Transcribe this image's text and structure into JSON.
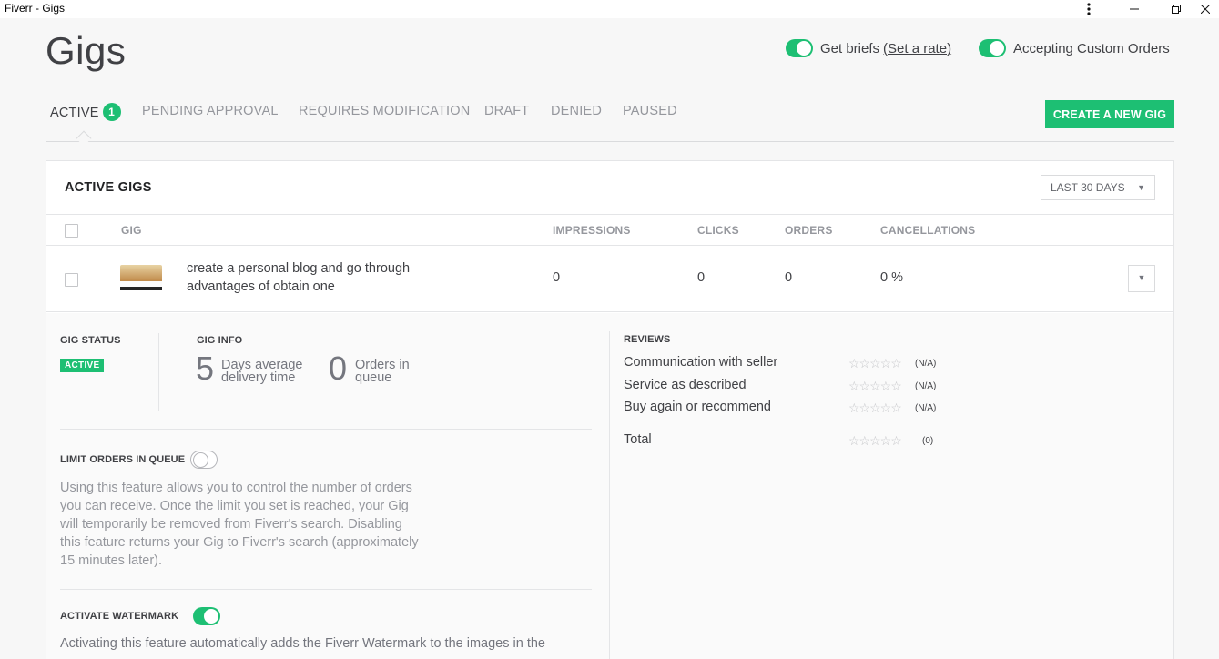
{
  "window": {
    "title": "Fiverr - Gigs",
    "more_icon": "more-vertical-icon",
    "minimize_icon": "minimize-icon",
    "restore_icon": "restore-icon",
    "close_icon": "close-icon"
  },
  "header": {
    "title": "Gigs",
    "get_briefs": {
      "label": "Get briefs",
      "link": "(Set a rate)",
      "on": true
    },
    "custom_orders": {
      "label": "Accepting Custom Orders",
      "on": true
    }
  },
  "tabs": [
    {
      "label": "ACTIVE",
      "count": "1",
      "active": true
    },
    {
      "label": "PENDING APPROVAL"
    },
    {
      "label": "REQUIRES MODIFICATION"
    },
    {
      "label": "DRAFT"
    },
    {
      "label": "DENIED"
    },
    {
      "label": "PAUSED"
    }
  ],
  "create_button": "CREATE A NEW GIG",
  "panel": {
    "title": "ACTIVE GIGS",
    "range": "LAST 30 DAYS",
    "columns": [
      "GIG",
      "IMPRESSIONS",
      "CLICKS",
      "ORDERS",
      "CANCELLATIONS"
    ],
    "rows": [
      {
        "title": "create a personal blog and go through advantages of obtain one",
        "impressions": "0",
        "clicks": "0",
        "orders": "0",
        "cancellations": "0 %"
      }
    ]
  },
  "details": {
    "status_heading": "GIG STATUS",
    "status": "ACTIVE",
    "info_heading": "GIG INFO",
    "delivery_days": "5",
    "delivery_label": "Days average delivery time",
    "orders_in_queue": "0",
    "queue_label": "Orders in queue",
    "limit_heading": "LIMIT ORDERS IN QUEUE",
    "limit_on": false,
    "limit_desc": "Using this feature allows you to control the number of orders you can receive. Once the limit you set is reached, your Gig will temporarily be removed from Fiverr's search. Disabling this feature returns your Gig to Fiverr's search (approximately 15 minutes later).",
    "watermark_heading": "ACTIVATE WATERMARK",
    "watermark_on": true,
    "watermark_desc": "Activating this feature automatically adds the Fiverr Watermark to the images in the"
  },
  "reviews": {
    "heading": "REVIEWS",
    "items": [
      {
        "label": "Communication with seller",
        "value": "(N/A)"
      },
      {
        "label": "Service as described",
        "value": "(N/A)"
      },
      {
        "label": "Buy again or recommend",
        "value": "(N/A)"
      }
    ],
    "total": {
      "label": "Total",
      "value": "(0)"
    },
    "star_glyphs": "☆☆☆☆☆"
  },
  "colors": {
    "accent": "#1dbf73",
    "text": "#404145",
    "muted": "#95979d"
  }
}
